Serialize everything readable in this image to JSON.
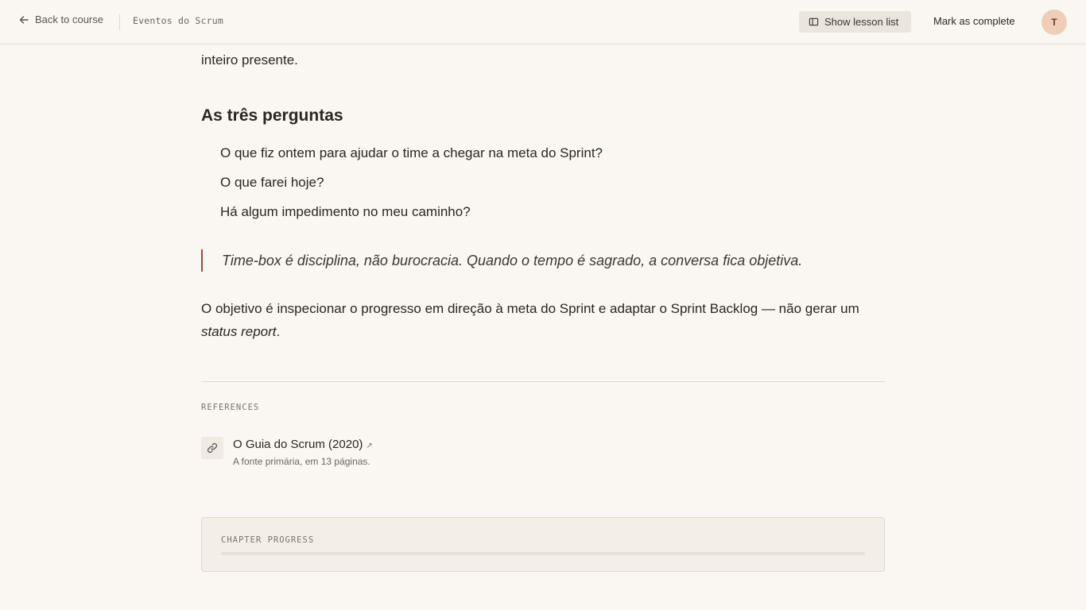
{
  "header": {
    "back_label": "Back to course",
    "chapter_title": "Eventos do Scrum",
    "lesson_list_label": "Show lesson list",
    "complete_label": "Mark as complete",
    "avatar_initial": "T"
  },
  "article": {
    "top_paragraph_tail": "inteiro presente.",
    "section_heading": "As três perguntas",
    "questions": [
      "O que fiz ontem para ajudar o time a chegar na meta do Sprint?",
      "O que farei hoje?",
      "Há algum impedimento no meu caminho?"
    ],
    "quote": "Time-box é disciplina, não burocracia. Quando o tempo é sagrado, a conversa fica objetiva.",
    "closing_paragraph": "O objetivo é inspecionar o progresso em direção à meta do Sprint e adaptar o Sprint Backlog — não gerar um",
    "closing_emphasis": "status report",
    "closing_end": "."
  },
  "references": {
    "label": "REFERENCES",
    "items": [
      {
        "title": "O Guia do Scrum (2020)",
        "external_glyph": "↗",
        "description": "A fonte primária, em 13 páginas.",
        "icon": "link-icon"
      }
    ]
  },
  "chapter_progress": {
    "label": "CHAPTER PROGRESS",
    "fraction": 0
  },
  "colors": {
    "background": "#faf7f2",
    "accent": "#9a4b3a",
    "avatar_bg": "#f0cdb8",
    "button_bg": "#ebe6dd"
  }
}
